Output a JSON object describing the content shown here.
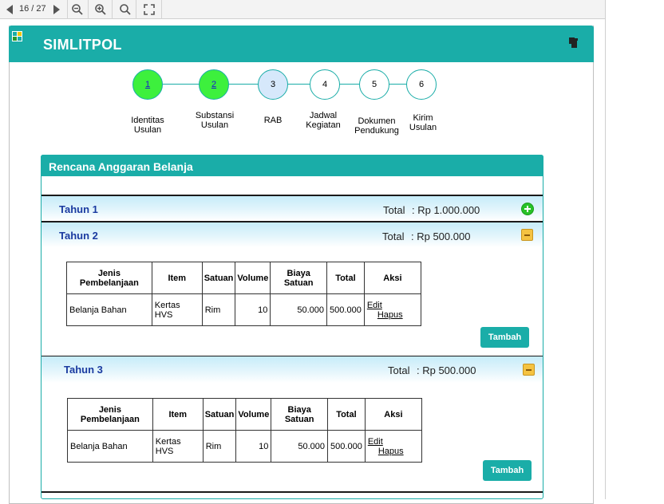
{
  "viewer": {
    "page_indicator": "16 / 27"
  },
  "app": {
    "title": "SIMLITPOL",
    "colors": {
      "primary": "#1aada8",
      "done": "#3df03d",
      "active": "#d6e8fb",
      "year_text": "#1a3aa0"
    }
  },
  "stepper": [
    {
      "num": "1",
      "label": [
        "Identitas",
        "Usulan"
      ],
      "state": "done"
    },
    {
      "num": "2",
      "label": [
        "Substansi",
        "Usulan"
      ],
      "state": "done"
    },
    {
      "num": "3",
      "label": [
        "RAB"
      ],
      "state": "active"
    },
    {
      "num": "4",
      "label": [
        "Jadwal",
        "Kegiatan"
      ],
      "state": "todo"
    },
    {
      "num": "5",
      "label": [
        "Dokumen",
        "Pendukung"
      ],
      "state": "todo"
    },
    {
      "num": "6",
      "label": [
        "Kirim",
        "Usulan"
      ],
      "state": "todo"
    }
  ],
  "panel": {
    "title": "Rencana Anggaran Belanja"
  },
  "years": [
    {
      "name": "Tahun 1",
      "total_label": "Total",
      "total_value": ": Rp 1.000.000",
      "icon": "add-icon"
    },
    {
      "name": "Tahun 2",
      "total_label": "Total",
      "total_value": ": Rp 500.000",
      "icon": "collapse-icon"
    },
    {
      "name": "Tahun 3",
      "total_label": "Total",
      "total_value": ": Rp 500.000",
      "icon": "collapse-icon"
    }
  ],
  "table": {
    "headers": [
      "Jenis Pembelanjaan",
      "Item",
      "Satuan",
      "Volume",
      "Biaya Satuan",
      "Total",
      "Aksi"
    ],
    "rows": [
      {
        "jenis": "Belanja Bahan",
        "item": "Kertas HVS",
        "satuan": "Rim",
        "volume": "10",
        "biaya": "50.000",
        "total": "500.000",
        "edit": "Edit",
        "hapus": "Hapus"
      }
    ]
  },
  "button_tambah": "Tambah"
}
